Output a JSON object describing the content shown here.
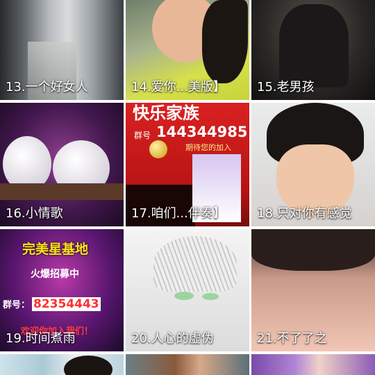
{
  "tiles": [
    {
      "label": "13.一个好女人"
    },
    {
      "label": "14.爱你...美版】"
    },
    {
      "label": "15.老男孩"
    },
    {
      "label": "16.小情歌"
    },
    {
      "label": "17.咱们...伴奏】"
    },
    {
      "label": "18.只对你有感觉"
    },
    {
      "label": "19.时间煮雨"
    },
    {
      "label": "20.人心的虚伪"
    },
    {
      "label": "21.不了了之"
    }
  ],
  "posters": {
    "kuaile": {
      "title": "快乐家族",
      "group_prefix": "群号",
      "number": "144344985",
      "slogan": "期待您的加入"
    },
    "wanmei": {
      "title": "完美星基地",
      "sub": "火爆招募中",
      "group_prefix": "群号：",
      "number": "82354443",
      "footer": "欢迎你加入我们！"
    }
  },
  "colors": {
    "bg": "#ffffff",
    "label": "#ffffff"
  }
}
